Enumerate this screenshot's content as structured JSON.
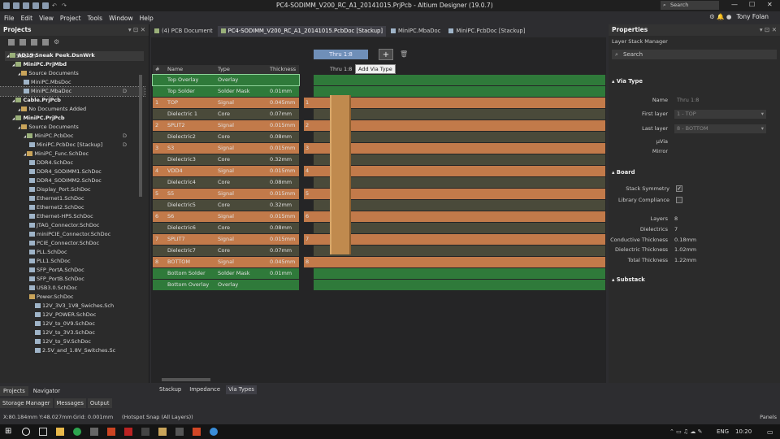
{
  "window": {
    "title": "PC4-SODIMM_V200_RC_A1_20141015.PrjPcb - Altium Designer (19.0.7)",
    "search_placeholder": "Search"
  },
  "menu": [
    "File",
    "Edit",
    "View",
    "Project",
    "Tools",
    "Window",
    "Help"
  ],
  "user": {
    "name": "Tony Folan"
  },
  "projects_panel": {
    "title": "Projects",
    "search_placeholder": "Search",
    "tree": [
      {
        "label": "AD19 Sneak Peek.DsnWrk",
        "indent": 0,
        "icon": "proj",
        "bold": true
      },
      {
        "label": "MiniPC.PrjMbd",
        "indent": 1,
        "icon": "proj",
        "bold": true
      },
      {
        "label": "Source Documents",
        "indent": 2,
        "icon": "fold"
      },
      {
        "label": "MiniPC.MbsDoc",
        "indent": 3,
        "icon": "doc"
      },
      {
        "label": "MiniPC.MbaDoc",
        "indent": 3,
        "icon": "doc",
        "selected": true,
        "flag": "D"
      },
      {
        "label": "Cable.PrjPcb",
        "indent": 1,
        "icon": "proj",
        "bold": true
      },
      {
        "label": "No Documents Added",
        "indent": 2,
        "icon": "fold"
      },
      {
        "label": "MiniPC.PrjPcb",
        "indent": 1,
        "icon": "proj",
        "bold": true
      },
      {
        "label": "Source Documents",
        "indent": 2,
        "icon": "fold"
      },
      {
        "label": "MiniPC.PcbDoc",
        "indent": 3,
        "icon": "proj",
        "flag": "D"
      },
      {
        "label": "MiniPC.PcbDoc [Stackup]",
        "indent": 4,
        "icon": "doc",
        "flag": "D"
      },
      {
        "label": "MiniPC_Func.SchDoc",
        "indent": 3,
        "icon": "fold"
      },
      {
        "label": "DDR4.SchDoc",
        "indent": 4,
        "icon": "doc"
      },
      {
        "label": "DDR4_SODIMM1.SchDoc",
        "indent": 4,
        "icon": "doc"
      },
      {
        "label": "DDR4_SODIMM2.SchDoc",
        "indent": 4,
        "icon": "doc"
      },
      {
        "label": "Display_Port.SchDoc",
        "indent": 4,
        "icon": "doc"
      },
      {
        "label": "Ethernet1.SchDoc",
        "indent": 4,
        "icon": "doc"
      },
      {
        "label": "Ethernet2.SchDoc",
        "indent": 4,
        "icon": "doc"
      },
      {
        "label": "Ethernet-HPS.SchDoc",
        "indent": 4,
        "icon": "doc"
      },
      {
        "label": "JTAG_Connector.SchDoc",
        "indent": 4,
        "icon": "doc"
      },
      {
        "label": "miniPCIE_Connector.SchDoc",
        "indent": 4,
        "icon": "doc"
      },
      {
        "label": "PCIE_Connector.SchDoc",
        "indent": 4,
        "icon": "doc"
      },
      {
        "label": "PLL.SchDoc",
        "indent": 4,
        "icon": "doc"
      },
      {
        "label": "PLL1.SchDoc",
        "indent": 4,
        "icon": "doc"
      },
      {
        "label": "SFP_PortA.SchDoc",
        "indent": 4,
        "icon": "doc"
      },
      {
        "label": "SFP_PortB.SchDoc",
        "indent": 4,
        "icon": "doc"
      },
      {
        "label": "USB3.0.SchDoc",
        "indent": 4,
        "icon": "doc"
      },
      {
        "label": "Power.SchDoc",
        "indent": 4,
        "icon": "fold"
      },
      {
        "label": "12V_3V3_1V8_Swiches.Sch",
        "indent": 5,
        "icon": "doc"
      },
      {
        "label": "12V_POWER.SchDoc",
        "indent": 5,
        "icon": "doc"
      },
      {
        "label": "12V_to_0V9.SchDoc",
        "indent": 5,
        "icon": "doc"
      },
      {
        "label": "12V_to_3V3.SchDoc",
        "indent": 5,
        "icon": "doc"
      },
      {
        "label": "12V_to_5V.SchDoc",
        "indent": 5,
        "icon": "doc"
      },
      {
        "label": "2.5V_and_1.8V_Switches.Sc",
        "indent": 5,
        "icon": "doc"
      }
    ],
    "tabs": [
      "Projects",
      "Navigator"
    ],
    "bottom_tabs": [
      "Storage Manager",
      "Messages",
      "Output"
    ]
  },
  "doc_tabs": [
    {
      "label": "(4) PCB Document",
      "color": "#9ab07a"
    },
    {
      "label": "PC4-SODIMM_V200_RC_A1_20141015.PcbDoc [Stackup]",
      "color": "#9ab07a",
      "active": true
    },
    {
      "label": "MiniPC.MbaDoc",
      "color": "#9fb4c8"
    },
    {
      "label": "MiniPC.PcbDoc [Stackup]",
      "color": "#9fb4c8"
    }
  ],
  "stackup": {
    "via_button": "Thru 1:8",
    "add_button": "+",
    "delete_button": "🗑",
    "tooltip": "Add Via Type",
    "headers": [
      "#",
      "Name",
      "Type",
      "Thickness"
    ],
    "via_column_header": "Thru 1:8",
    "rows": [
      {
        "n": "",
        "name": "Top Overlay",
        "type": "Overlay",
        "thick": "",
        "kind": "overlay",
        "sel": true
      },
      {
        "n": "",
        "name": "Top Solder",
        "type": "Solder Mask",
        "thick": "0.01mm",
        "kind": "mask"
      },
      {
        "n": "1",
        "name": "TOP",
        "type": "Signal",
        "thick": "0.045mm",
        "kind": "signal",
        "vn": "1"
      },
      {
        "n": "",
        "name": "Dielectric 1",
        "type": "Core",
        "thick": "0.07mm",
        "kind": "diel"
      },
      {
        "n": "2",
        "name": "SPLIT2",
        "type": "Signal",
        "thick": "0.015mm",
        "kind": "signal",
        "vn": "2"
      },
      {
        "n": "",
        "name": "Dielectric2",
        "type": "Core",
        "thick": "0.08mm",
        "kind": "diel"
      },
      {
        "n": "3",
        "name": "S3",
        "type": "Signal",
        "thick": "0.015mm",
        "kind": "signal",
        "vn": "3"
      },
      {
        "n": "",
        "name": "Dielectric3",
        "type": "Core",
        "thick": "0.32mm",
        "kind": "diel"
      },
      {
        "n": "4",
        "name": "VDD4",
        "type": "Signal",
        "thick": "0.015mm",
        "kind": "signal",
        "vn": "4"
      },
      {
        "n": "",
        "name": "Dielectric4",
        "type": "Core",
        "thick": "0.08mm",
        "kind": "diel"
      },
      {
        "n": "5",
        "name": "S5",
        "type": "Signal",
        "thick": "0.015mm",
        "kind": "signal",
        "vn": "5"
      },
      {
        "n": "",
        "name": "Dielectric5",
        "type": "Core",
        "thick": "0.32mm",
        "kind": "diel"
      },
      {
        "n": "6",
        "name": "S6",
        "type": "Signal",
        "thick": "0.015mm",
        "kind": "signal",
        "vn": "6"
      },
      {
        "n": "",
        "name": "Dielectric6",
        "type": "Core",
        "thick": "0.08mm",
        "kind": "diel"
      },
      {
        "n": "7",
        "name": "SPLIT7",
        "type": "Signal",
        "thick": "0.015mm",
        "kind": "signal",
        "vn": "7"
      },
      {
        "n": "",
        "name": "Dielectric7",
        "type": "Core",
        "thick": "0.07mm",
        "kind": "diel"
      },
      {
        "n": "8",
        "name": "BOTTOM",
        "type": "Signal",
        "thick": "0.045mm",
        "kind": "signal",
        "vn": "8"
      },
      {
        "n": "",
        "name": "Bottom Solder",
        "type": "Solder Mask",
        "thick": "0.01mm",
        "kind": "mask"
      },
      {
        "n": "",
        "name": "Bottom Overlay",
        "type": "Overlay",
        "thick": "",
        "kind": "overlay"
      }
    ],
    "bottom_tabs": [
      "Stackup",
      "Impedance",
      "Via Types"
    ]
  },
  "colors": {
    "overlay": "#2f7a3a",
    "mask": "#2f7a3a",
    "signal": "#c27a4a",
    "diel": "#4a4a3a",
    "viaband": "#3a5a3a"
  },
  "properties": {
    "title": "Properties",
    "subtitle": "Layer Stack Manager",
    "search_placeholder": "Search",
    "via_section": "Via Type",
    "name_label": "Name",
    "name_value": "Thru 1:8",
    "first_label": "First layer",
    "first_value": "1 - TOP",
    "last_label": "Last layer",
    "last_value": "8 - BOTTOM",
    "uvia_label": "µVia",
    "mirror_label": "Mirror",
    "board_section": "Board",
    "symmetry_label": "Stack Symmetry",
    "library_label": "Library Compliance",
    "layers_label": "Layers",
    "layers_value": "8",
    "diel_label": "Dielectrics",
    "diel_value": "7",
    "cond_label": "Conductive Thickness",
    "cond_value": "0.18mm",
    "dielt_label": "Dielectric Thickness",
    "dielt_value": "1.02mm",
    "total_label": "Total Thickness",
    "total_value": "1.22mm",
    "substack_section": "Substack"
  },
  "status": {
    "coords": "X:80.184mm Y:48.027mm",
    "grid": "Grid: 0.001mm",
    "snap": "(Hotspot Snap (All Layers))",
    "panels": "Panels"
  },
  "taskbar": {
    "lang": "ENG",
    "time": "10:20"
  }
}
